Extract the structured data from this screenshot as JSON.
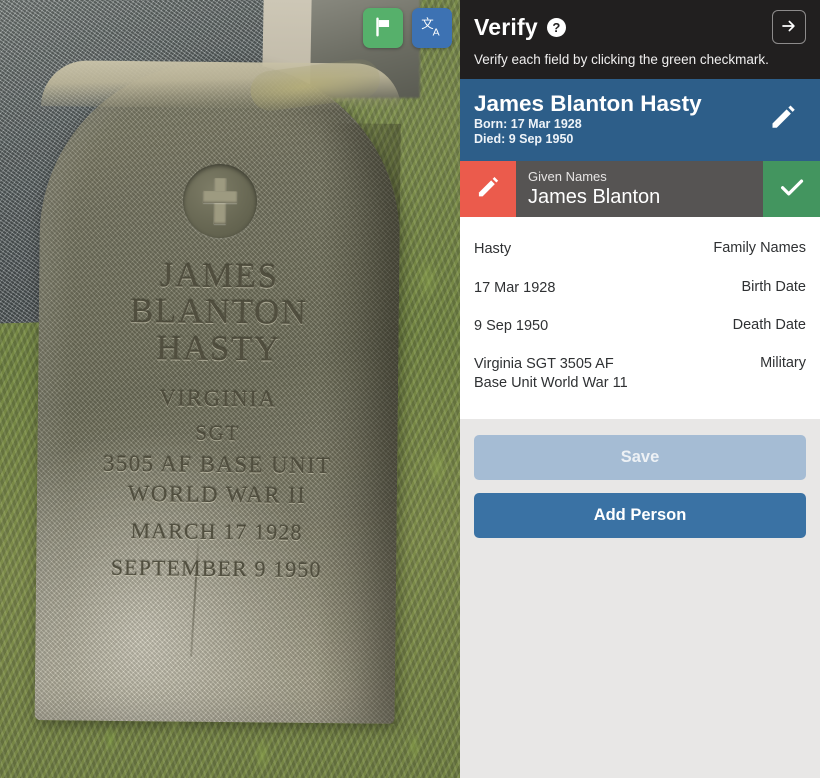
{
  "photo": {
    "alt_description": "Military headstone photograph in a cemetery",
    "headstone_inscription": {
      "name_lines": [
        "JAMES",
        "BLANTON",
        "HASTY"
      ],
      "state": "VIRGINIA",
      "rank": "SGT",
      "unit": "3505 AF BASE UNIT",
      "war": "WORLD WAR II",
      "birth_date_line": "MARCH 17 1928",
      "death_date_line": "SEPTEMBER 9 1950"
    },
    "actions": [
      {
        "name": "flag-button",
        "icon": "flag-icon",
        "color": "#56b06b"
      },
      {
        "name": "translate-button",
        "icon": "translate-icon",
        "color": "#3d72b3"
      }
    ]
  },
  "panel": {
    "header": {
      "title": "Verify",
      "help_label": "?",
      "next_label": "→",
      "instruction": "Verify each field by clicking the green checkmark."
    },
    "person": {
      "name": "James Blanton Hasty",
      "born": "Born: 17 Mar 1928",
      "died": "Died: 9 Sep 1950",
      "edit_icon": "pencil-icon"
    },
    "active_field": {
      "label": "Given Names",
      "value": "James Blanton",
      "edit_icon": "pencil-icon",
      "confirm_icon": "checkmark-icon",
      "edit_color": "#eb5b4c",
      "confirm_color": "#43955f"
    },
    "fields": [
      {
        "value": "Hasty",
        "label": "Family Names"
      },
      {
        "value": "17 Mar 1928",
        "label": "Birth Date"
      },
      {
        "value": "9 Sep 1950",
        "label": "Death Date"
      },
      {
        "value": "Virginia SGT 3505 AF\nBase Unit World War 11",
        "label": "Military"
      }
    ],
    "buttons": {
      "save": "Save",
      "add_person": "Add Person"
    },
    "colors": {
      "header_bg": "#211f1f",
      "person_bg": "#2d5e89",
      "panel_bg": "#e8e7e6",
      "save_bg": "#a5bcd4",
      "add_person_bg": "#3a72a4"
    }
  }
}
